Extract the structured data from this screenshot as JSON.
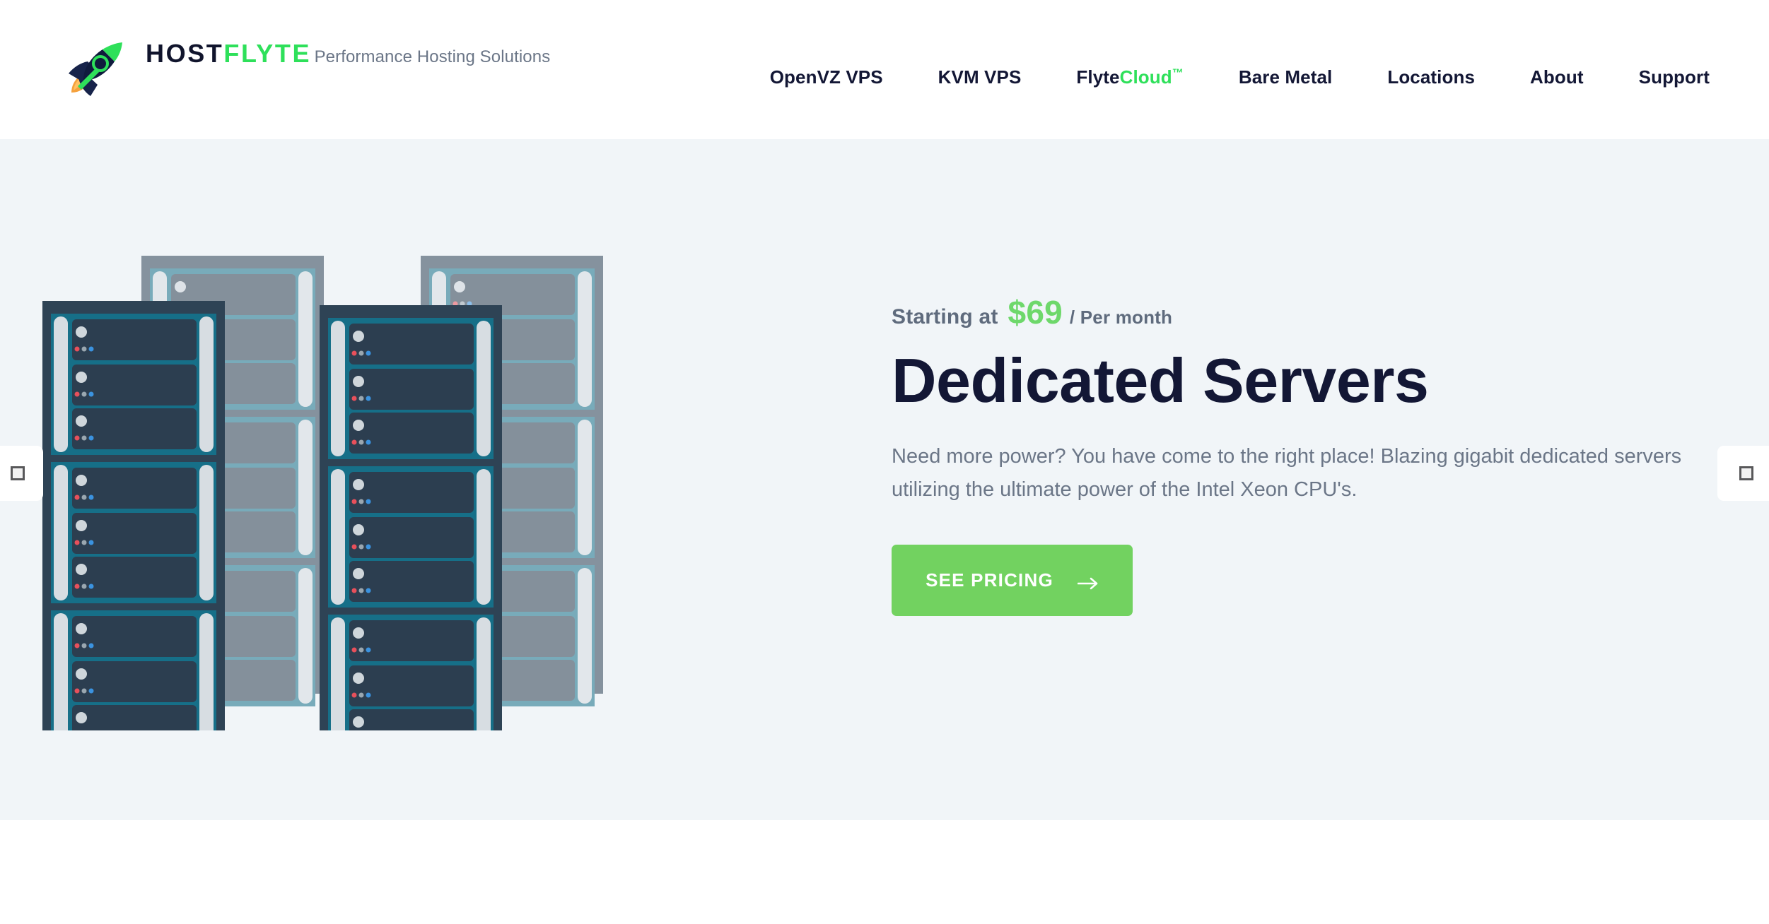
{
  "brand": {
    "logo_icon": "rocket-icon",
    "name_part1": "HOST",
    "name_part2": "FLYTE",
    "tagline": "Performance Hosting Solutions",
    "color_dark": "#10142c",
    "color_green": "#2ee05a"
  },
  "nav": {
    "items": [
      {
        "label": "OpenVZ VPS"
      },
      {
        "label": "KVM VPS"
      },
      {
        "label": "FlyteCloud",
        "accent": "Cloud",
        "prefix": "Flyte",
        "tm": "™"
      },
      {
        "label": "Bare Metal"
      },
      {
        "label": "Locations"
      },
      {
        "label": "About"
      },
      {
        "label": "Support"
      }
    ]
  },
  "hero": {
    "price_prefix": "Starting at",
    "price_amount": "$69",
    "price_period": "/ Per month",
    "title": "Dedicated Servers",
    "description": "Need more power? You have come to the right place! Blazing gigabit dedicated servers utilizing the ultimate power of the Intel Xeon CPU's.",
    "cta_label": "SEE PRICING",
    "cta_icon": "arrow-right-icon",
    "background_color": "#f1f5f8",
    "accent_green": "#72d260",
    "price_green": "#6ed86b",
    "illustration_alt": "server-racks-illustration"
  },
  "carousel": {
    "prev_icon": "missing-glyph-icon",
    "next_icon": "missing-glyph-icon"
  }
}
